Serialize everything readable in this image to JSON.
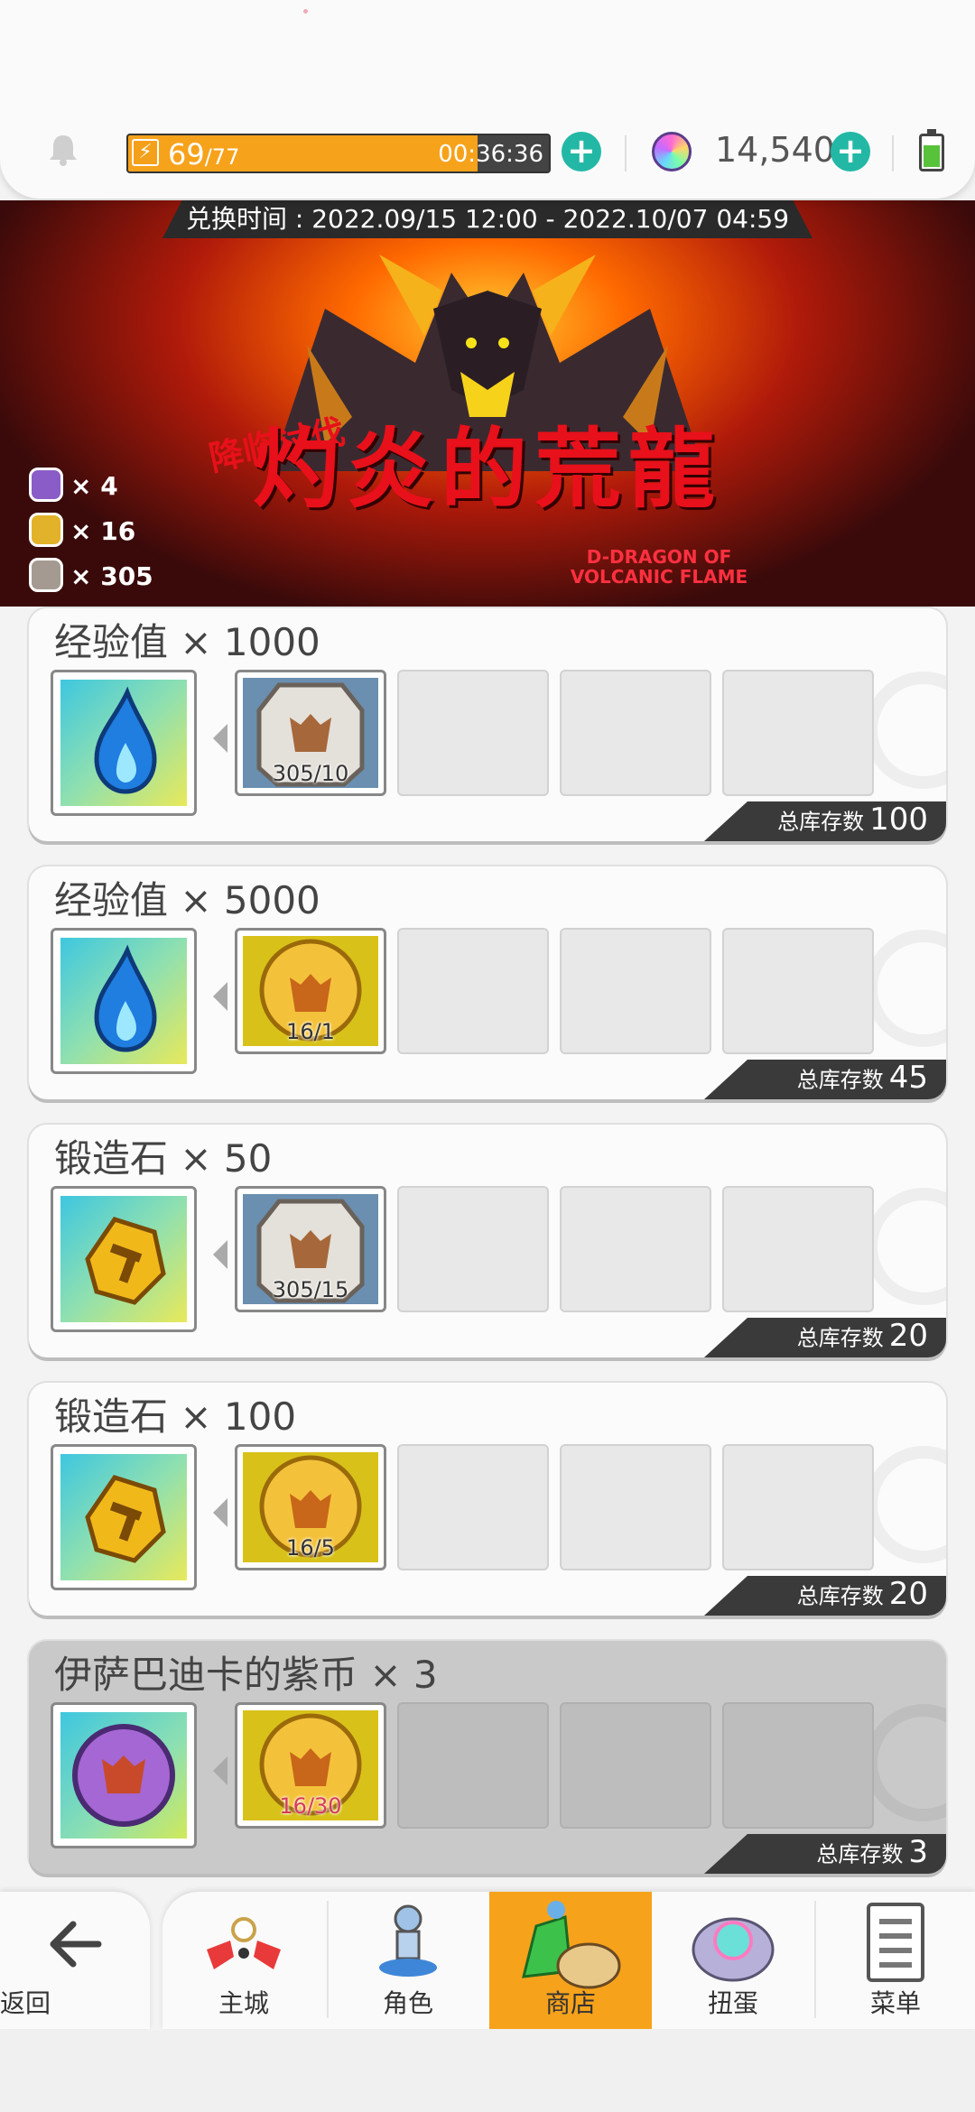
{
  "header": {
    "stamina_current": "69",
    "stamina_max": "/77",
    "stamina_fraction": 0.83,
    "stamina_timer": "00:36:36",
    "gems": "14,540",
    "bell_icon": "bell-icon",
    "accent_color": "#22b8a5",
    "stamina_color": "#f7a21b"
  },
  "banner": {
    "exchange_time": "兑换时间 : 2022.09/15 12:00 - 2022.10/07 04:59",
    "title": "灼炎的荒龍",
    "subtitle": "降临讨伐",
    "english_title": "D-DRAGON OF VOLCANIC FLAME",
    "coins": [
      {
        "icon": "purple-coin-icon",
        "color": "#8a5cc8",
        "text": "× 4"
      },
      {
        "icon": "gold-coin-icon",
        "color": "#e2b22a",
        "text": "× 16"
      },
      {
        "icon": "silver-coin-icon",
        "color": "#a59a92",
        "text": "× 305"
      }
    ]
  },
  "exchange_items": [
    {
      "title": "经验值 × 1000",
      "reward_icon": "blue-flame-icon",
      "cost_icon": "silver-coin-icon",
      "cost": "305/10",
      "stock_label": "总库存数",
      "stock": "100",
      "affordable": true
    },
    {
      "title": "经验值 × 5000",
      "reward_icon": "blue-flame-icon",
      "cost_icon": "gold-coin-icon",
      "cost": "16/1",
      "stock_label": "总库存数",
      "stock": "45",
      "affordable": true
    },
    {
      "title": "锻造石 × 50",
      "reward_icon": "forge-stone-icon",
      "cost_icon": "silver-coin-icon",
      "cost": "305/15",
      "stock_label": "总库存数",
      "stock": "20",
      "affordable": true
    },
    {
      "title": "锻造石 × 100",
      "reward_icon": "forge-stone-icon",
      "cost_icon": "gold-coin-icon",
      "cost": "16/5",
      "stock_label": "总库存数",
      "stock": "20",
      "affordable": true
    },
    {
      "title": "伊萨巴迪卡的紫币 × 3",
      "reward_icon": "purple-coin-icon",
      "cost_icon": "gold-coin-icon",
      "cost": "16/30",
      "stock_label": "总库存数",
      "stock": "3",
      "affordable": false
    }
  ],
  "nav": {
    "back": "返回",
    "items": [
      {
        "label": "主城",
        "icon": "town-icon",
        "active": false
      },
      {
        "label": "角色",
        "icon": "character-icon",
        "active": false
      },
      {
        "label": "商店",
        "icon": "shop-icon",
        "active": true
      },
      {
        "label": "扭蛋",
        "icon": "gacha-icon",
        "active": false
      },
      {
        "label": "菜单",
        "icon": "menu-list-icon",
        "active": false
      }
    ]
  }
}
